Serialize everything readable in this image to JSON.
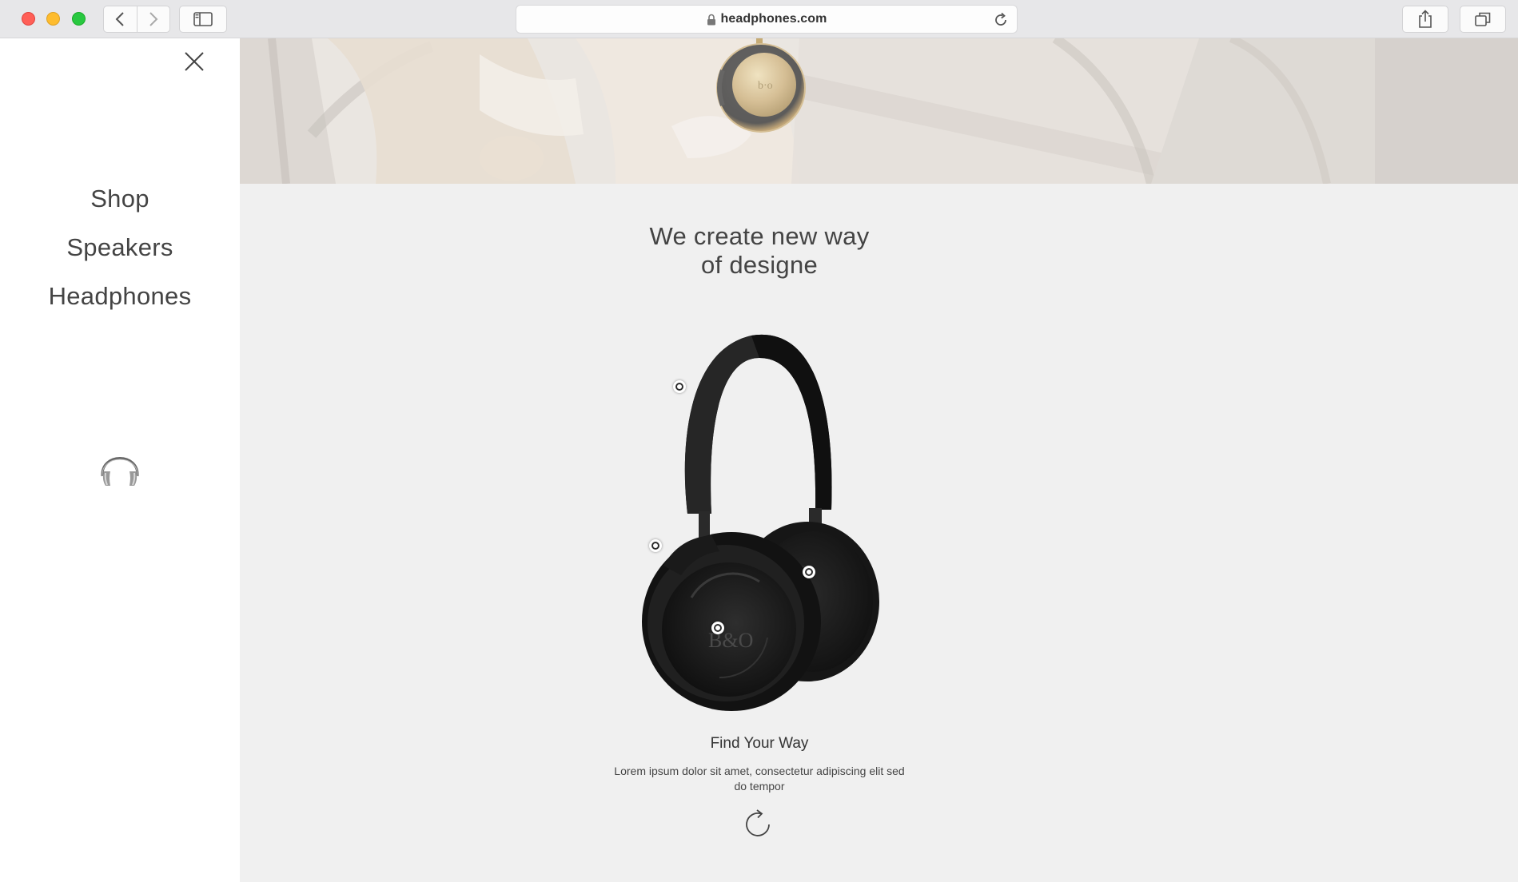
{
  "browser": {
    "url": "headphones.com",
    "colors": {
      "close": "#ff5f57",
      "minimize": "#febc2e",
      "zoom": "#28c840"
    }
  },
  "sidebar": {
    "menu": [
      {
        "label": "Shop"
      },
      {
        "label": "Speakers"
      },
      {
        "label": "Headphones"
      }
    ],
    "logo_icon": "headphones-icon"
  },
  "main": {
    "heading_line1": "We create new way",
    "heading_line2": "of designe",
    "product": {
      "title": "Find Your Way",
      "description_line1": "Lorem ipsum dolor sit amet, consectetur adipiscing elit sed",
      "description_line2": "do tempor",
      "hotspot_count": 4
    }
  }
}
